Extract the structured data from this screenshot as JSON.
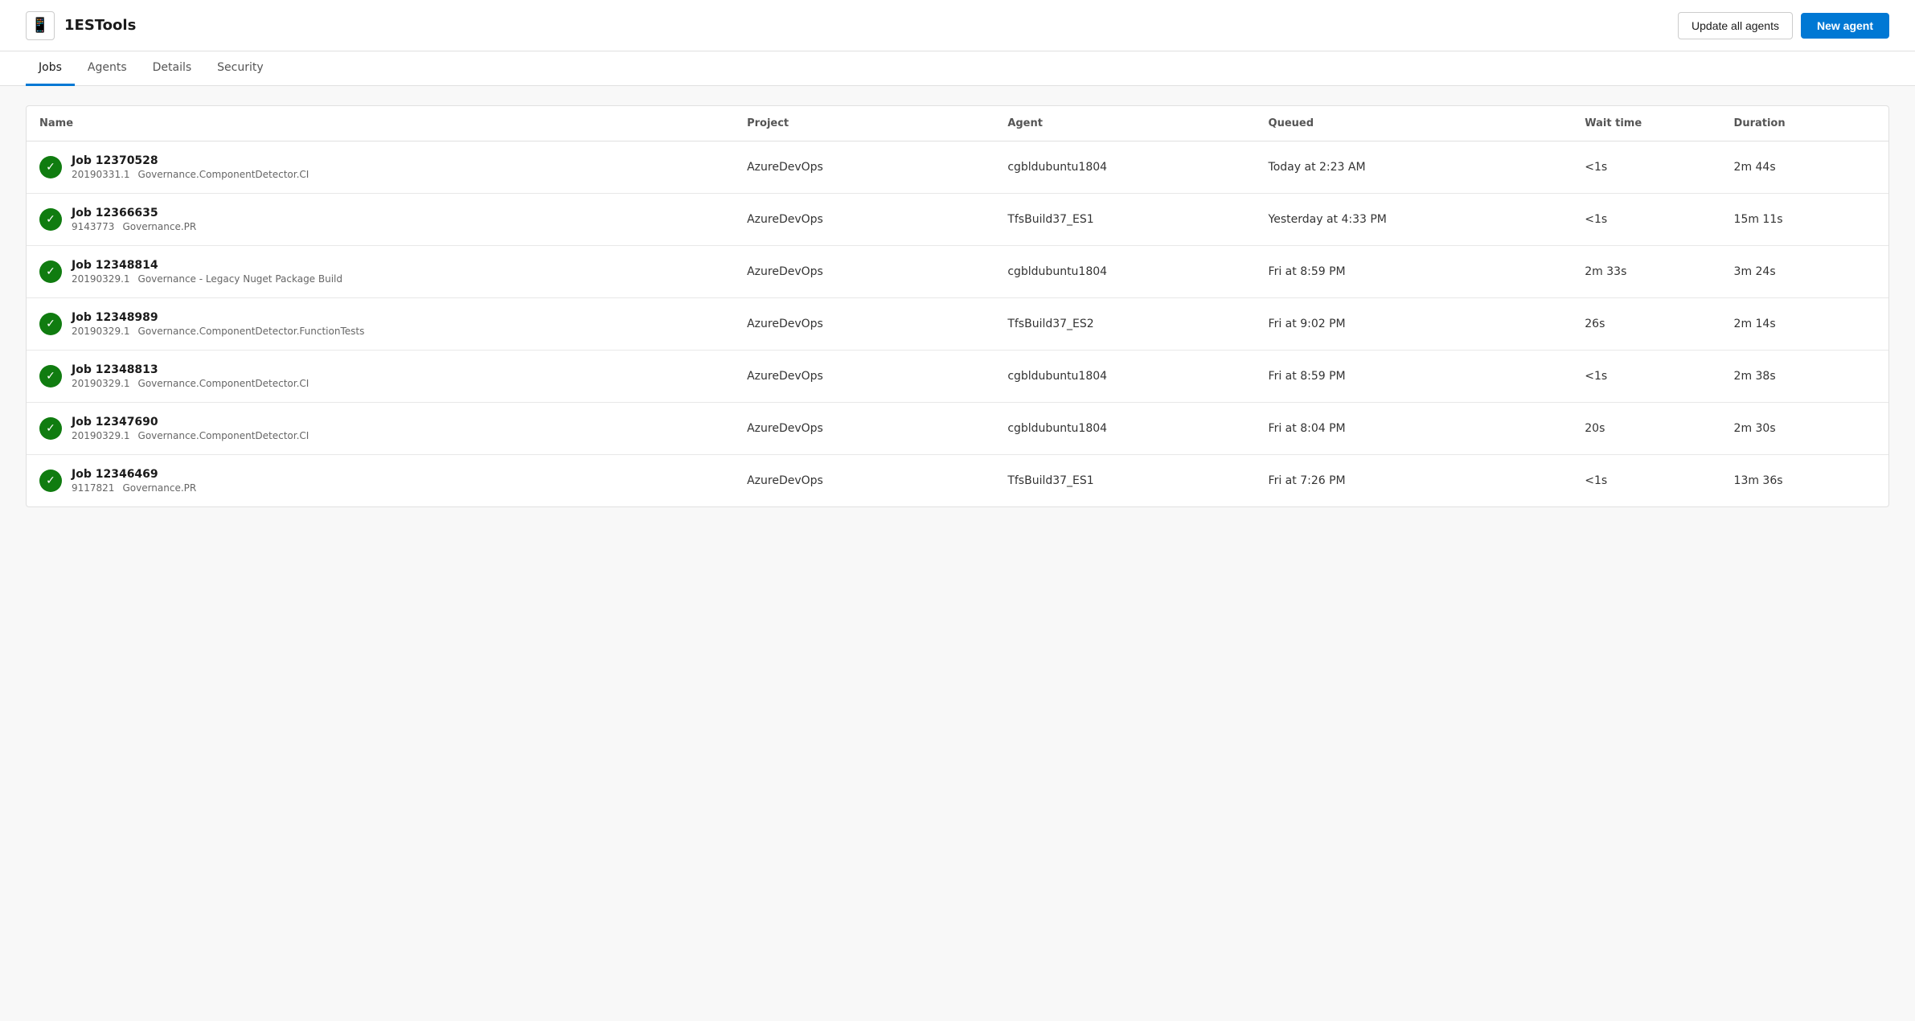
{
  "header": {
    "icon": "📱",
    "title": "1ESTools",
    "update_agents_label": "Update all agents",
    "new_agent_label": "New agent"
  },
  "tabs": [
    {
      "id": "jobs",
      "label": "Jobs",
      "active": true
    },
    {
      "id": "agents",
      "label": "Agents",
      "active": false
    },
    {
      "id": "details",
      "label": "Details",
      "active": false
    },
    {
      "id": "security",
      "label": "Security",
      "active": false
    }
  ],
  "table": {
    "columns": [
      {
        "id": "name",
        "label": "Name"
      },
      {
        "id": "project",
        "label": "Project"
      },
      {
        "id": "agent",
        "label": "Agent"
      },
      {
        "id": "queued",
        "label": "Queued"
      },
      {
        "id": "wait_time",
        "label": "Wait time"
      },
      {
        "id": "duration",
        "label": "Duration"
      }
    ],
    "rows": [
      {
        "job_title": "Job 12370528",
        "job_id": "20190331.1",
        "job_pipeline": "Governance.ComponentDetector.CI",
        "project": "AzureDevOps",
        "agent": "cgbldubuntu1804",
        "queued": "Today at 2:23 AM",
        "wait_time": "<1s",
        "duration": "2m 44s",
        "status": "success"
      },
      {
        "job_title": "Job 12366635",
        "job_id": "9143773",
        "job_pipeline": "Governance.PR",
        "project": "AzureDevOps",
        "agent": "TfsBuild37_ES1",
        "queued": "Yesterday at 4:33 PM",
        "wait_time": "<1s",
        "duration": "15m 11s",
        "status": "success"
      },
      {
        "job_title": "Job 12348814",
        "job_id": "20190329.1",
        "job_pipeline": "Governance - Legacy Nuget Package Build",
        "project": "AzureDevOps",
        "agent": "cgbldubuntu1804",
        "queued": "Fri at 8:59 PM",
        "wait_time": "2m 33s",
        "duration": "3m 24s",
        "status": "success"
      },
      {
        "job_title": "Job 12348989",
        "job_id": "20190329.1",
        "job_pipeline": "Governance.ComponentDetector.FunctionTests",
        "project": "AzureDevOps",
        "agent": "TfsBuild37_ES2",
        "queued": "Fri at 9:02 PM",
        "wait_time": "26s",
        "duration": "2m 14s",
        "status": "success"
      },
      {
        "job_title": "Job 12348813",
        "job_id": "20190329.1",
        "job_pipeline": "Governance.ComponentDetector.CI",
        "project": "AzureDevOps",
        "agent": "cgbldubuntu1804",
        "queued": "Fri at 8:59 PM",
        "wait_time": "<1s",
        "duration": "2m 38s",
        "status": "success"
      },
      {
        "job_title": "Job 12347690",
        "job_id": "20190329.1",
        "job_pipeline": "Governance.ComponentDetector.CI",
        "project": "AzureDevOps",
        "agent": "cgbldubuntu1804",
        "queued": "Fri at 8:04 PM",
        "wait_time": "20s",
        "duration": "2m 30s",
        "status": "success"
      },
      {
        "job_title": "Job 12346469",
        "job_id": "9117821",
        "job_pipeline": "Governance.PR",
        "project": "AzureDevOps",
        "agent": "TfsBuild37_ES1",
        "queued": "Fri at 7:26 PM",
        "wait_time": "<1s",
        "duration": "13m 36s",
        "status": "success"
      }
    ]
  }
}
